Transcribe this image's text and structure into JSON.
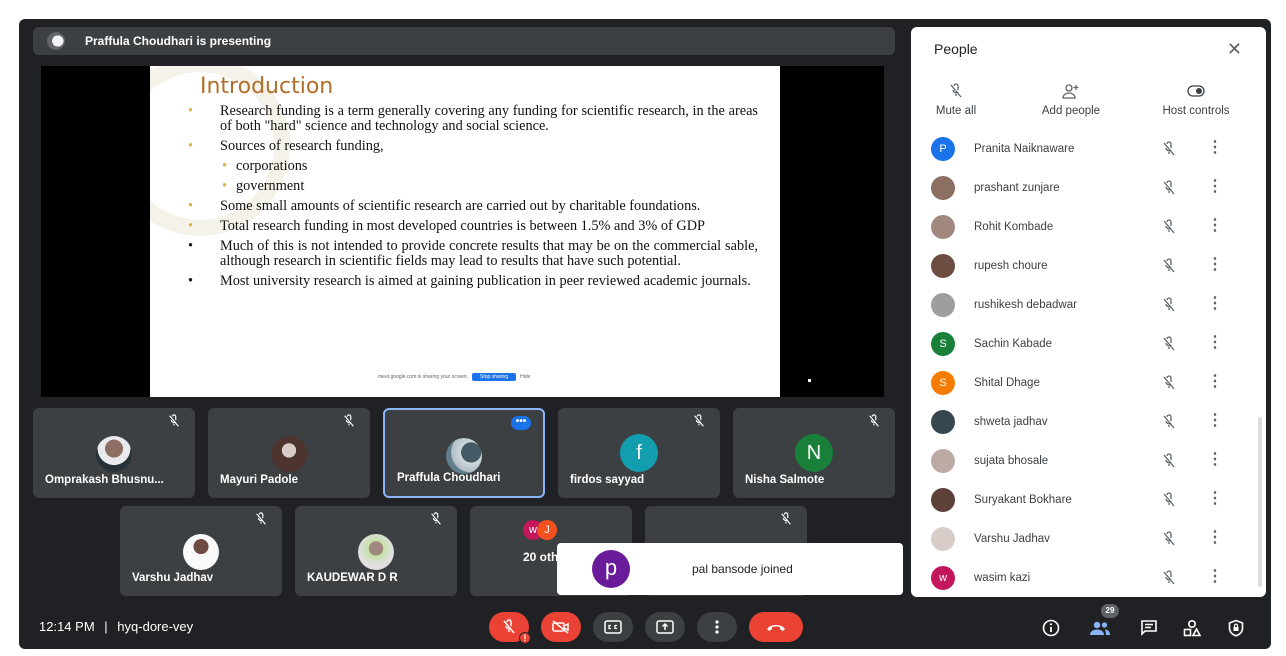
{
  "presenting": {
    "text": "Praffula Choudhari is presenting"
  },
  "slide": {
    "title": "Introduction",
    "bullets": [
      "Research funding is a term generally covering any funding for scientific research, in the areas of both \"hard\" science and technology and social science.",
      "Sources of research funding,",
      "corporations",
      "government",
      "Some small amounts of scientific research are carried out by charitable foundations.",
      "Total research funding in most developed countries is between 1.5% and 3% of GDP",
      "Much of this is not intended to provide concrete results that may be on the commercial sable, although research in scientific fields may lead to results that have such potential.",
      "Most university research is aimed at gaining publication in peer reviewed academic journals."
    ],
    "share_banner": {
      "text": "meet.google.com is sharing your screen.",
      "stop_label": "Stop sharing",
      "hide_label": "Hide"
    }
  },
  "tiles": [
    {
      "name": "Omprakash Bhusnu...",
      "muted": true
    },
    {
      "name": "Mayuri Padole",
      "muted": true
    },
    {
      "name": "Praffula Choudhari",
      "muted": false,
      "more_label": "•••"
    },
    {
      "name": "firdos sayyad",
      "initial": "f",
      "color": "#129eaf",
      "muted": true
    },
    {
      "name": "Nisha Salmote",
      "initial": "N",
      "color": "#188038",
      "muted": true
    },
    {
      "name": "Varshu Jadhav",
      "muted": true
    },
    {
      "name": "KAUDEWAR D R",
      "muted": true
    },
    {
      "name": "20 others",
      "muted": false,
      "mini_initials": [
        "w",
        "J"
      ]
    },
    {
      "name": "",
      "muted": true
    }
  ],
  "toast": {
    "initial": "p",
    "text": "pal bansode joined"
  },
  "people_panel": {
    "title": "People",
    "actions": {
      "mute_all": "Mute all",
      "add_people": "Add people",
      "host_controls": "Host controls"
    },
    "participants": [
      {
        "name": "Pranita Naiknaware",
        "initial": "P",
        "color": "#1a73e8"
      },
      {
        "name": "prashant zunjare",
        "initial": "",
        "color": "#8d6e63"
      },
      {
        "name": "Rohit Kombade",
        "initial": "",
        "color": "#a1887f"
      },
      {
        "name": "rupesh choure",
        "initial": "",
        "color": "#6d4c41"
      },
      {
        "name": "rushikesh debadwar",
        "initial": "",
        "color": "#9e9e9e"
      },
      {
        "name": "Sachin Kabade",
        "initial": "S",
        "color": "#188038"
      },
      {
        "name": "Shital Dhage",
        "initial": "S",
        "color": "#f57c00"
      },
      {
        "name": "shweta jadhav",
        "initial": "",
        "color": "#37474f"
      },
      {
        "name": "sujata bhosale",
        "initial": "",
        "color": "#bcaaa4"
      },
      {
        "name": "Suryakant Bokhare",
        "initial": "",
        "color": "#5d4037"
      },
      {
        "name": "Varshu Jadhav",
        "initial": "",
        "color": "#d7ccc8"
      },
      {
        "name": "wasim kazi",
        "initial": "w",
        "color": "#c2185b"
      }
    ]
  },
  "bottom_bar": {
    "time": "12:14 PM",
    "separator": "|",
    "meeting_code": "hyq-dore-vey",
    "people_count": "29"
  },
  "colors": {
    "stage": "#202124",
    "tile": "#3c4043",
    "end_call": "#ea4335",
    "accent": "#1a73e8"
  }
}
